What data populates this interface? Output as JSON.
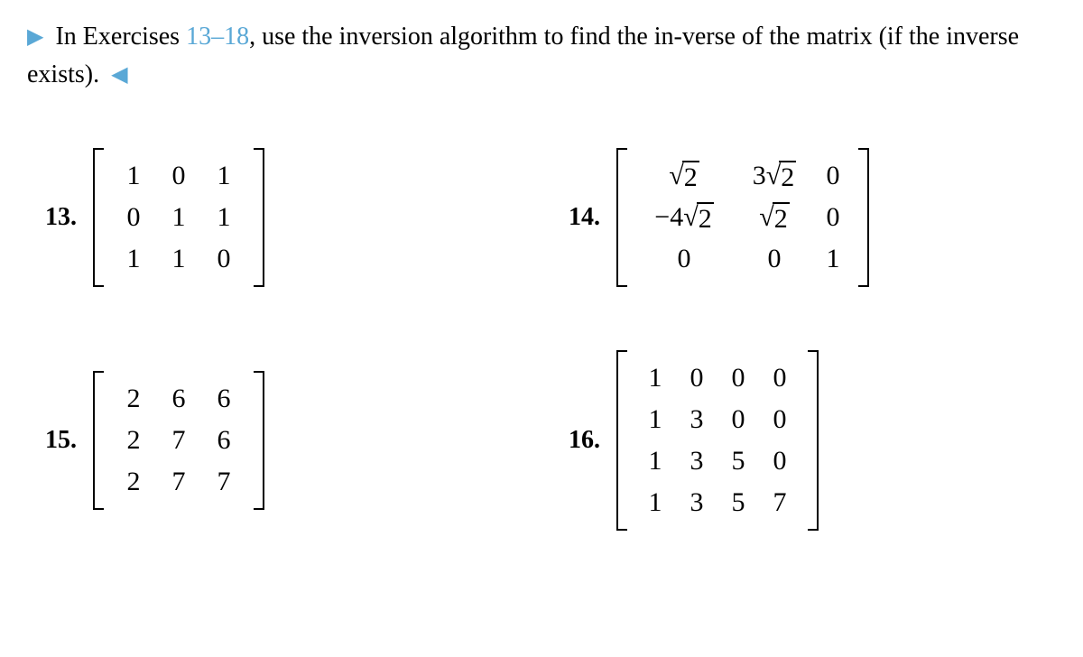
{
  "instruction": {
    "prefix": "In Exercises ",
    "range": "13–18",
    "suffix": ", use the inversion algorithm to find the in-verse of the matrix (if the inverse exists)."
  },
  "problems": {
    "p13": {
      "num": "13.",
      "rows": 3,
      "cols": 3,
      "cells": [
        "1",
        "0",
        "1",
        "0",
        "1",
        "1",
        "1",
        "1",
        "0"
      ]
    },
    "p14": {
      "num": "14.",
      "rows": 3,
      "cols": 3,
      "cells": [
        "√2",
        "3√2",
        "0",
        "−4√2",
        "√2",
        "0",
        "0",
        "0",
        "1"
      ]
    },
    "p15": {
      "num": "15.",
      "rows": 3,
      "cols": 3,
      "cells": [
        "2",
        "6",
        "6",
        "2",
        "7",
        "6",
        "2",
        "7",
        "7"
      ]
    },
    "p16": {
      "num": "16.",
      "rows": 4,
      "cols": 4,
      "cells": [
        "1",
        "0",
        "0",
        "0",
        "1",
        "3",
        "0",
        "0",
        "1",
        "3",
        "5",
        "0",
        "1",
        "3",
        "5",
        "7"
      ]
    }
  }
}
